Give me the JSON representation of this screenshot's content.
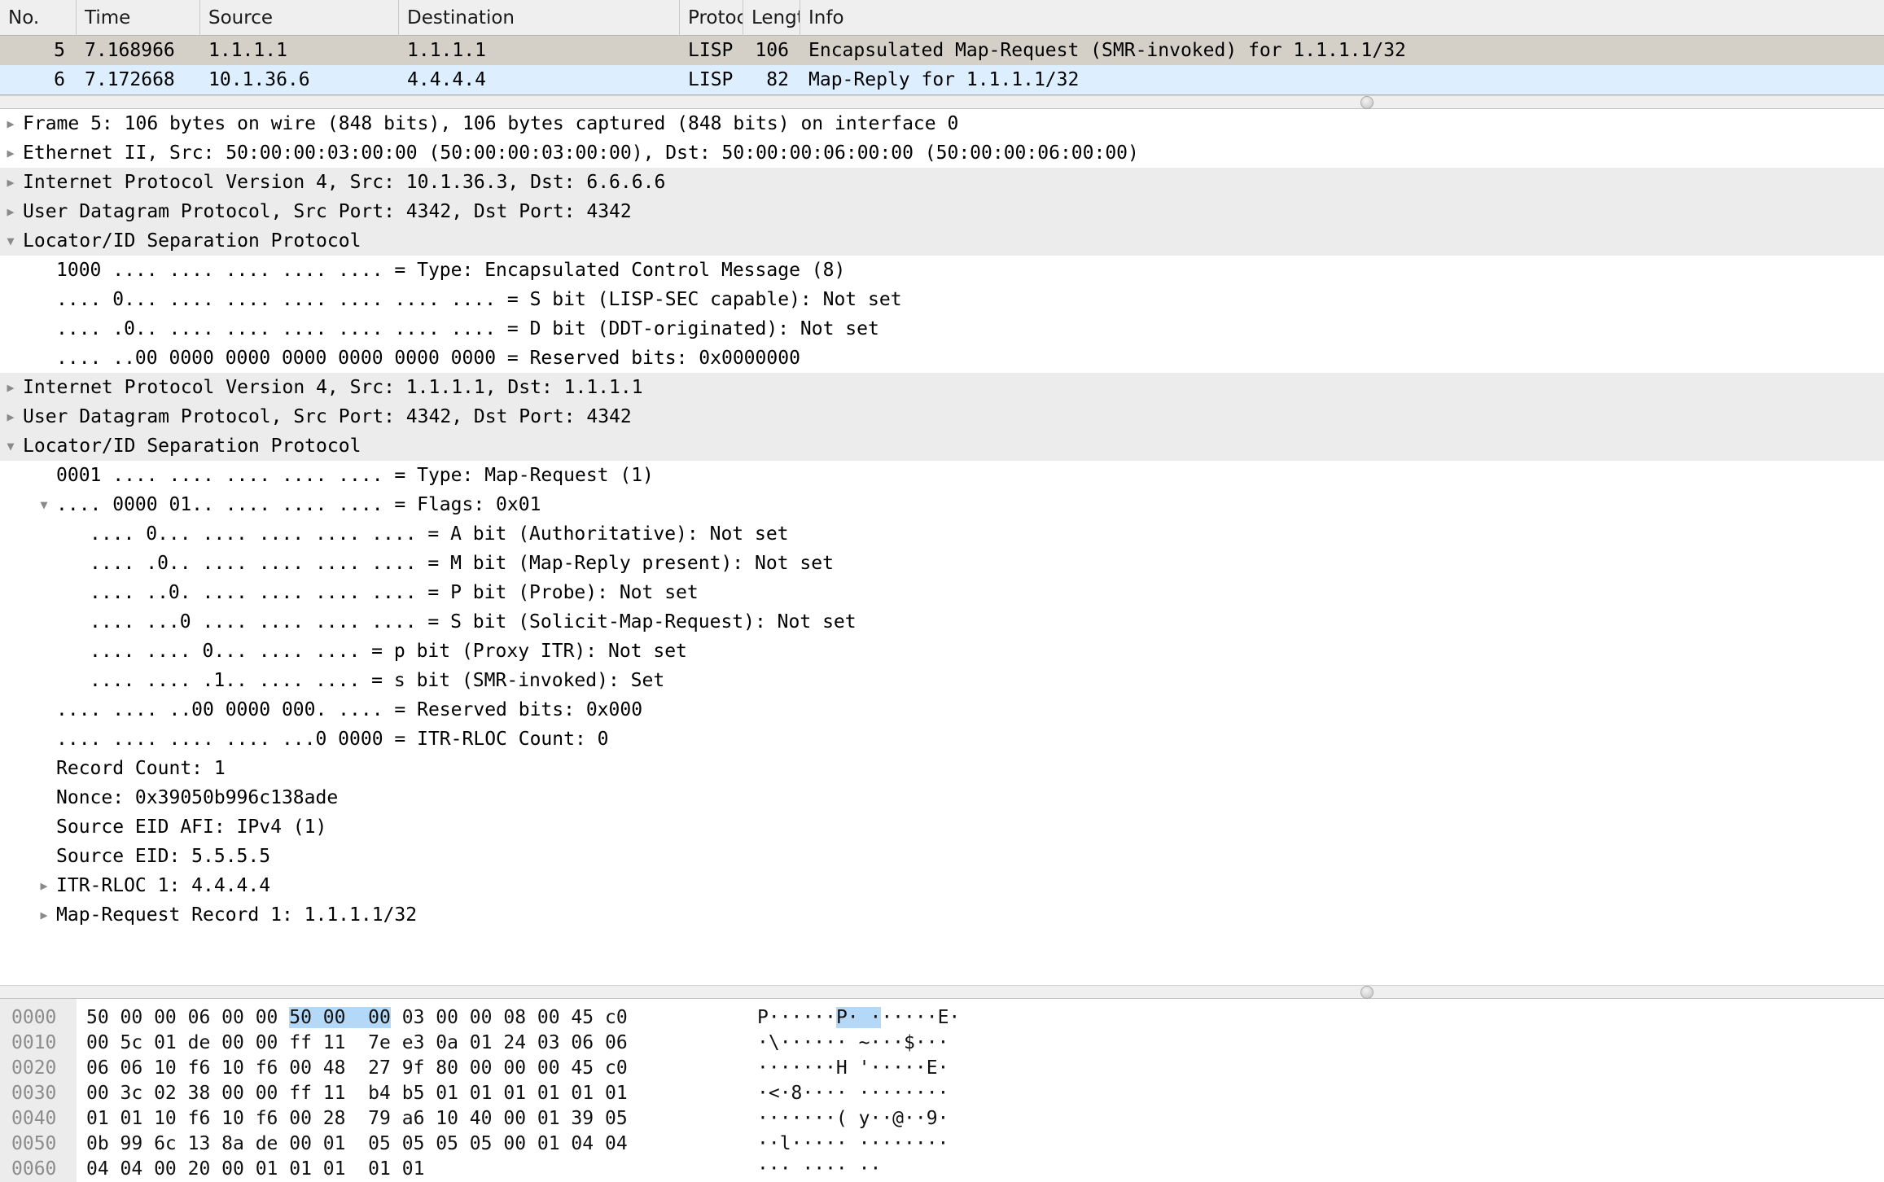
{
  "packet_list": {
    "columns": [
      "No.",
      "Time",
      "Source",
      "Destination",
      "Protocol",
      "Length",
      "Info"
    ],
    "rows": [
      {
        "no": "5",
        "time": "7.168966",
        "source": "1.1.1.1",
        "destination": "1.1.1.1",
        "protocol": "LISP",
        "length": "106",
        "info": "Encapsulated Map-Request (SMR-invoked) for 1.1.1.1/32",
        "state": "selected"
      },
      {
        "no": "6",
        "time": "7.172668",
        "source": "10.1.36.6",
        "destination": "4.4.4.4",
        "protocol": "LISP",
        "length": "82",
        "info": "Map-Reply for 1.1.1.1/32",
        "state": "alt"
      }
    ]
  },
  "detail_tree": [
    {
      "indent": 0,
      "twisty": "collapsed",
      "selected": false,
      "text": "Frame 5: 106 bytes on wire (848 bits), 106 bytes captured (848 bits) on interface 0"
    },
    {
      "indent": 0,
      "twisty": "collapsed",
      "selected": false,
      "text": "Ethernet II, Src: 50:00:00:03:00:00 (50:00:00:03:00:00), Dst: 50:00:00:06:00:00 (50:00:00:06:00:00)"
    },
    {
      "indent": 0,
      "twisty": "collapsed",
      "selected": true,
      "text": "Internet Protocol Version 4, Src: 10.1.36.3, Dst: 6.6.6.6"
    },
    {
      "indent": 0,
      "twisty": "collapsed",
      "selected": true,
      "text": "User Datagram Protocol, Src Port: 4342, Dst Port: 4342"
    },
    {
      "indent": 0,
      "twisty": "expanded",
      "selected": true,
      "text": "Locator/ID Separation Protocol"
    },
    {
      "indent": 1,
      "twisty": "none",
      "selected": false,
      "text": "1000 .... .... .... .... .... = Type: Encapsulated Control Message (8)"
    },
    {
      "indent": 1,
      "twisty": "none",
      "selected": false,
      "text": ".... 0... .... .... .... .... .... .... = S bit (LISP-SEC capable): Not set"
    },
    {
      "indent": 1,
      "twisty": "none",
      "selected": false,
      "text": ".... .0.. .... .... .... .... .... .... = D bit (DDT-originated): Not set"
    },
    {
      "indent": 1,
      "twisty": "none",
      "selected": false,
      "text": ".... ..00 0000 0000 0000 0000 0000 0000 = Reserved bits: 0x0000000"
    },
    {
      "indent": 0,
      "twisty": "collapsed",
      "selected": true,
      "text": "Internet Protocol Version 4, Src: 1.1.1.1, Dst: 1.1.1.1"
    },
    {
      "indent": 0,
      "twisty": "collapsed",
      "selected": true,
      "text": "User Datagram Protocol, Src Port: 4342, Dst Port: 4342"
    },
    {
      "indent": 0,
      "twisty": "expanded",
      "selected": true,
      "text": "Locator/ID Separation Protocol"
    },
    {
      "indent": 1,
      "twisty": "none",
      "selected": false,
      "text": "0001 .... .... .... .... .... = Type: Map-Request (1)"
    },
    {
      "indent": 1,
      "twisty": "expanded",
      "selected": false,
      "text": ".... 0000 01.. .... .... .... = Flags: 0x01"
    },
    {
      "indent": 2,
      "twisty": "none",
      "selected": false,
      "text": ".... 0... .... .... .... .... = A bit (Authoritative): Not set"
    },
    {
      "indent": 2,
      "twisty": "none",
      "selected": false,
      "text": ".... .0.. .... .... .... .... = M bit (Map-Reply present): Not set"
    },
    {
      "indent": 2,
      "twisty": "none",
      "selected": false,
      "text": ".... ..0. .... .... .... .... = P bit (Probe): Not set"
    },
    {
      "indent": 2,
      "twisty": "none",
      "selected": false,
      "text": ".... ...0 .... .... .... .... = S bit (Solicit-Map-Request): Not set"
    },
    {
      "indent": 2,
      "twisty": "none",
      "selected": false,
      "text": ".... .... 0... .... .... = p bit (Proxy ITR): Not set"
    },
    {
      "indent": 2,
      "twisty": "none",
      "selected": false,
      "text": ".... .... .1.. .... .... = s bit (SMR-invoked): Set"
    },
    {
      "indent": 1,
      "twisty": "none",
      "selected": false,
      "text": ".... .... ..00 0000 000. .... = Reserved bits: 0x000"
    },
    {
      "indent": 1,
      "twisty": "none",
      "selected": false,
      "text": ".... .... .... .... ...0 0000 = ITR-RLOC Count: 0"
    },
    {
      "indent": 1,
      "twisty": "none",
      "selected": false,
      "text": "Record Count: 1"
    },
    {
      "indent": 1,
      "twisty": "none",
      "selected": false,
      "text": "Nonce: 0x39050b996c138ade"
    },
    {
      "indent": 1,
      "twisty": "none",
      "selected": false,
      "text": "Source EID AFI: IPv4 (1)"
    },
    {
      "indent": 1,
      "twisty": "none",
      "selected": false,
      "text": "Source EID: 5.5.5.5"
    },
    {
      "indent": 1,
      "twisty": "collapsed",
      "selected": false,
      "text": "ITR-RLOC 1: 4.4.4.4"
    },
    {
      "indent": 1,
      "twisty": "collapsed",
      "selected": false,
      "text": "Map-Request Record 1: 1.1.1.1/32"
    }
  ],
  "hex_dump": {
    "rows": [
      {
        "offset": "0000",
        "bytes_pre": "50 00 00 06 00 00 ",
        "bytes_hl": "50 00  00",
        "bytes_post": " 03 00 00 08 00 45 c0",
        "ascii_pre": "P······",
        "ascii_hl": "P· ·",
        "ascii_post": "·····E·"
      },
      {
        "offset": "0010",
        "bytes_pre": "00 5c 01 de 00 00 ff 11  7e e3 0a 01 24 03 06 06",
        "bytes_hl": "",
        "bytes_post": "",
        "ascii_pre": "·\\······ ~···$···",
        "ascii_hl": "",
        "ascii_post": ""
      },
      {
        "offset": "0020",
        "bytes_pre": "06 06 10 f6 10 f6 00 48  27 9f 80 00 00 00 45 c0",
        "bytes_hl": "",
        "bytes_post": "",
        "ascii_pre": "·······H '·····E·",
        "ascii_hl": "",
        "ascii_post": ""
      },
      {
        "offset": "0030",
        "bytes_pre": "00 3c 02 38 00 00 ff 11  b4 b5 01 01 01 01 01 01",
        "bytes_hl": "",
        "bytes_post": "",
        "ascii_pre": "·<·8···· ········",
        "ascii_hl": "",
        "ascii_post": ""
      },
      {
        "offset": "0040",
        "bytes_pre": "01 01 10 f6 10 f6 00 28  79 a6 10 40 00 01 39 05",
        "bytes_hl": "",
        "bytes_post": "",
        "ascii_pre": "·······( y··@··9·",
        "ascii_hl": "",
        "ascii_post": ""
      },
      {
        "offset": "0050",
        "bytes_pre": "0b 99 6c 13 8a de 00 01  05 05 05 05 00 01 04 04",
        "bytes_hl": "",
        "bytes_post": "",
        "ascii_pre": "··l····· ········",
        "ascii_hl": "",
        "ascii_post": ""
      },
      {
        "offset": "0060",
        "bytes_pre": "04 04 00 20 00 01 01 01  01 01",
        "bytes_hl": "",
        "bytes_post": "",
        "ascii_pre": "··· ···· ··",
        "ascii_hl": "",
        "ascii_post": ""
      }
    ]
  },
  "colors": {
    "selected_row": "#d4d0c8",
    "alt_row": "#ddeeff",
    "highlight": "#b4d8f8",
    "tree_selected": "#ececec",
    "header_bg": "#efefef"
  }
}
